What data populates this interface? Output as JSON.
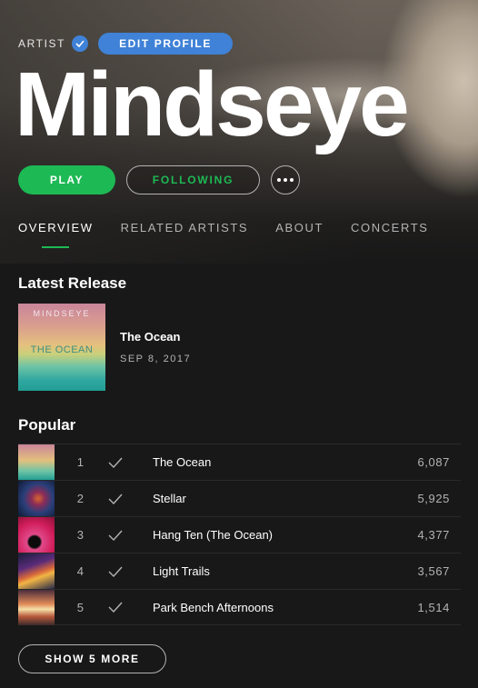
{
  "header": {
    "artist_label": "ARTIST",
    "edit_profile_label": "EDIT PROFILE",
    "artist_name": "Mindseye",
    "play_label": "PLAY",
    "following_label": "FOLLOWING"
  },
  "tabs": [
    {
      "label": "OVERVIEW",
      "active": true
    },
    {
      "label": "RELATED ARTISTS",
      "active": false
    },
    {
      "label": "ABOUT",
      "active": false
    },
    {
      "label": "CONCERTS",
      "active": false
    }
  ],
  "latest_release": {
    "section_title": "Latest Release",
    "cover_brand": "MINDSEYE",
    "cover_title": "THE OCEAN",
    "title": "The Ocean",
    "date": "SEP 8, 2017"
  },
  "popular": {
    "section_title": "Popular",
    "tracks": [
      {
        "num": "1",
        "title": "The Ocean",
        "plays": "6,087"
      },
      {
        "num": "2",
        "title": "Stellar",
        "plays": "5,925"
      },
      {
        "num": "3",
        "title": "Hang Ten (The Ocean)",
        "plays": "4,377"
      },
      {
        "num": "4",
        "title": "Light Trails",
        "plays": "3,567"
      },
      {
        "num": "5",
        "title": "Park Bench Afternoons",
        "plays": "1,514"
      }
    ],
    "show_more_label": "SHOW 5 MORE"
  },
  "colors": {
    "accent_green": "#1db954",
    "accent_blue": "#3f82d7",
    "background": "#181818"
  },
  "icons": [
    "verified-check-icon",
    "more-dots-icon",
    "saved-check-icon"
  ]
}
